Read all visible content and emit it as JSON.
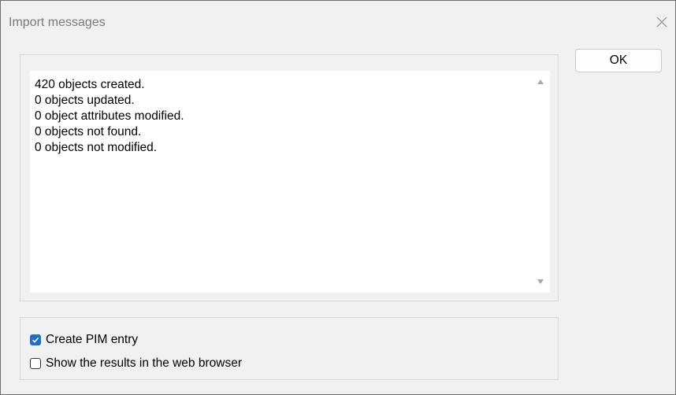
{
  "dialog": {
    "title": "Import messages",
    "close_icon": "close-icon"
  },
  "messages": {
    "lines": [
      "420 objects created.",
      "0 objects updated.",
      "0 object attributes modified.",
      "0 objects not found.",
      "0 objects not modified."
    ]
  },
  "options": {
    "create_pim": {
      "label": "Create PIM entry",
      "checked": true
    },
    "show_browser": {
      "label": "Show the results in the web browser",
      "checked": false
    }
  },
  "buttons": {
    "ok_label": "OK"
  },
  "colors": {
    "accent": "#1f6ecd",
    "dialog_bg": "#f0f0f0"
  }
}
